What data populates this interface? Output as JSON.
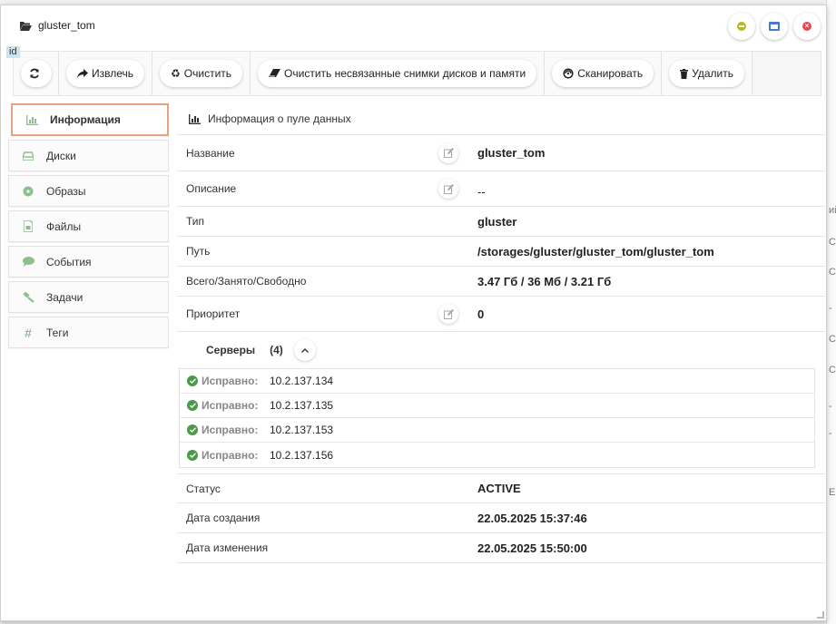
{
  "window": {
    "title": "gluster_tom"
  },
  "badge": "id",
  "toolbar": {
    "refresh_label": "",
    "extract_label": "Извлечь",
    "clean_label": "Очистить",
    "clean_unlinked_label": "Очистить несвязанные снимки дисков и памяти",
    "scan_label": "Сканировать",
    "delete_label": "Удалить"
  },
  "sidebar": {
    "items": [
      {
        "label": "Информация",
        "icon": "bar-chart-icon"
      },
      {
        "label": "Диски",
        "icon": "drive-icon"
      },
      {
        "label": "Образы",
        "icon": "disc-icon"
      },
      {
        "label": "Файлы",
        "icon": "file-icon"
      },
      {
        "label": "События",
        "icon": "comment-icon"
      },
      {
        "label": "Задачи",
        "icon": "gavel-icon"
      },
      {
        "label": "Теги",
        "icon": "hash-icon"
      }
    ]
  },
  "main": {
    "header": "Информация о пуле данных",
    "fields": {
      "name": {
        "label": "Название",
        "value": "gluster_tom"
      },
      "description": {
        "label": "Описание",
        "value": "--"
      },
      "type": {
        "label": "Тип",
        "value": "gluster"
      },
      "path": {
        "label": "Путь",
        "value": "/storages/gluster/gluster_tom/gluster_tom"
      },
      "space": {
        "label": "Всего/Занято/Свободно",
        "value": "3.47 Гб / 36 Мб / 3.21 Гб"
      },
      "priority": {
        "label": "Приоритет",
        "value": "0"
      },
      "status": {
        "label": "Статус",
        "value": "ACTIVE"
      },
      "created": {
        "label": "Дата создания",
        "value": "22.05.2025 15:37:46"
      },
      "modified": {
        "label": "Дата изменения",
        "value": "22.05.2025 15:50:00"
      }
    },
    "servers": {
      "label": "Серверы",
      "count": "(4)",
      "items": [
        {
          "status": "Исправно:",
          "ip": "10.2.137.134"
        },
        {
          "status": "Исправно:",
          "ip": "10.2.137.135"
        },
        {
          "status": "Исправно:",
          "ip": "10.2.137.153"
        },
        {
          "status": "Исправно:",
          "ip": "10.2.137.156"
        }
      ]
    }
  },
  "background": {
    "cells": [
      "ий",
      "С",
      "С",
      "-",
      "С",
      "С",
      "-",
      "-",
      "Е"
    ]
  },
  "colors": {
    "active_border": "#e8a17f",
    "ok_green": "#4a9a4a",
    "sidebar_icon": "#8cc08c"
  }
}
